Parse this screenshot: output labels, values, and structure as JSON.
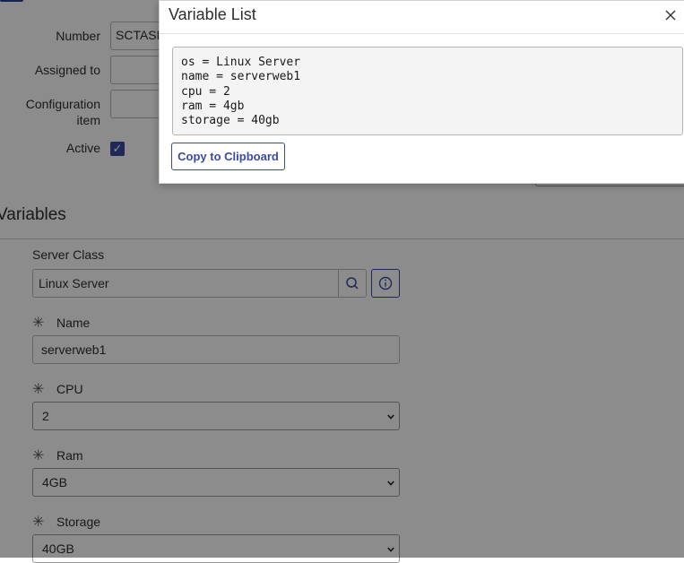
{
  "form": {
    "fields": [
      {
        "label": "Number",
        "value": "SCTASK"
      },
      {
        "label": "Assigned to",
        "value": ""
      },
      {
        "label": "Configuration item",
        "label_line1": "Configuration",
        "label_line2": "item",
        "value": ""
      },
      {
        "label": "Active",
        "checked": true
      }
    ]
  },
  "variables": {
    "title": "Variables",
    "server_class": {
      "label": "Server Class",
      "value": "Linux Server"
    },
    "name": {
      "label": "Name",
      "value": "serverweb1",
      "required": true
    },
    "cpu": {
      "label": "CPU",
      "value": "2",
      "required": true
    },
    "ram": {
      "label": "Ram",
      "value": "4GB",
      "required": true
    },
    "storage": {
      "label": "Storage",
      "value": "40GB",
      "required": true
    }
  },
  "modal": {
    "title": "Variable List",
    "lines": [
      "os = Linux Server",
      "name = serverweb1",
      "cpu = 2",
      "ram = 4gb",
      "storage = 40gb"
    ],
    "copy_button": "Copy to Clipboard"
  },
  "icons": {
    "close": "close-icon",
    "search": "search-icon",
    "info": "info-icon",
    "chevron": "chevron-down-icon",
    "required": "required-asterisk-icon",
    "check": "checkmark-icon"
  },
  "colors": {
    "accent": "#3b4aa5",
    "overlay": "rgba(0,0,0,0.45)"
  }
}
